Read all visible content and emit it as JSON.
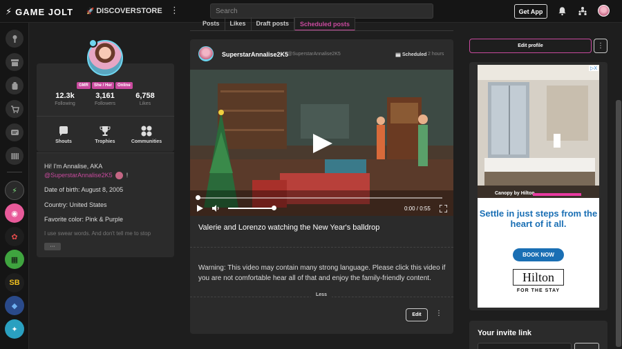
{
  "topbar": {
    "logo": "GAME JOLT",
    "discover": "DISCOVER",
    "store": "STORE",
    "more": "⋮",
    "search_placeholder": "Search",
    "get_app": "Get App"
  },
  "profile": {
    "tags": [
      "GMR",
      "She / Her",
      "Online"
    ],
    "stats": [
      {
        "value": "12.3k",
        "label": "Following"
      },
      {
        "value": "3,161",
        "label": "Followers"
      },
      {
        "value": "6,758",
        "label": "Likes"
      }
    ],
    "quick_links": [
      {
        "label": "Shouts",
        "icon": "chat-bubble-icon"
      },
      {
        "label": "Trophies",
        "icon": "trophy-icon"
      },
      {
        "label": "Communities",
        "icon": "grid-icon"
      }
    ],
    "bio": {
      "line1": "Hi! I'm Annalise, AKA",
      "mention": "@SuperstarAnnalise2K5",
      "mention_suffix": "!",
      "dob": "Date of birth: August 8, 2005",
      "country": "Country: United States",
      "color": "Favorite color: Pink & Purple",
      "faded": "I use swear words. And don't tell me to stop",
      "more": "···"
    }
  },
  "tabs": [
    "Posts",
    "Likes",
    "Draft posts",
    "Scheduled posts"
  ],
  "post": {
    "username": "SuperstarAnnalise2K5",
    "handle": "@SuperstarAnnalise2K5",
    "scheduled": "Scheduled",
    "time": "2 hours",
    "video_time": "0:00 / 0:55",
    "video_progress": 0.0,
    "volume": 0.9,
    "title": "Valerie and Lorenzo watching the New Year's balldrop",
    "body": "Warning: This video may contain many strong language. Please click this video if you are not comfortable hear all of that and enjoy the family-friendly content.",
    "less": "Less",
    "edit": "Edit",
    "more": "⋮"
  },
  "right": {
    "edit_profile": "Edit profile",
    "more": "⋮",
    "ad": {
      "info": "▷X",
      "caption": "Canopy by Hilton",
      "headline": "Settle in just steps from the heart of it all.",
      "cta": "BOOK NOW",
      "brand": "Hilton",
      "tagline": "FOR THE STAY"
    },
    "invite_title": "Your invite link"
  },
  "colors": {
    "accent": "#c94a9e",
    "background": "#1e1e1e",
    "card": "#2b2b2b",
    "ad_blue": "#1a6fb4"
  }
}
